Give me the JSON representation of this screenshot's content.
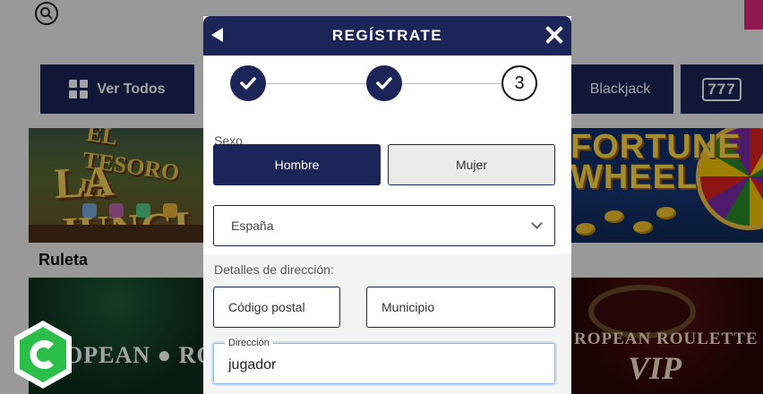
{
  "background": {
    "search_icon": "search-icon",
    "category_tabs": [
      {
        "label": "Ver Todos",
        "icon": "grid-icon"
      },
      {
        "label": "Blackjack",
        "icon": ""
      },
      {
        "label": "",
        "icon": "777-icon"
      }
    ],
    "slots_badge": "777",
    "games_row1": [
      {
        "title_line1": "EL TESORO DE",
        "title_line2": "LA JUNGLA"
      },
      {
        "title_line1": "FORTUNE",
        "title_line2": "WHEEL"
      }
    ],
    "section_title": "Ruleta",
    "games_row2": [
      {
        "title": "OPEAN ● ROUL"
      },
      {
        "title": "ROPEAN ROULETTE",
        "subtitle": "VIP"
      }
    ],
    "brand_logo": "C"
  },
  "modal": {
    "title": "REGÍSTRATE",
    "back_icon": "back-arrow-icon",
    "close_icon": "close-icon",
    "steps": [
      {
        "state": "done",
        "label": ""
      },
      {
        "state": "done",
        "label": ""
      },
      {
        "state": "current",
        "label": "3"
      }
    ],
    "gender": {
      "label": "Sexo",
      "options": [
        "Hombre",
        "Mujer"
      ],
      "selected": "Hombre"
    },
    "country": {
      "value": "España"
    },
    "address": {
      "section_label": "Detalles de dirección:",
      "postal_code_placeholder": "Código postal",
      "municipality_placeholder": "Municipio",
      "street_label": "Dirección",
      "street_value": "jugador"
    }
  },
  "colors": {
    "primary": "#1b2557",
    "brand_pink": "#e0287a",
    "logo_green": "#2bbf4a"
  }
}
